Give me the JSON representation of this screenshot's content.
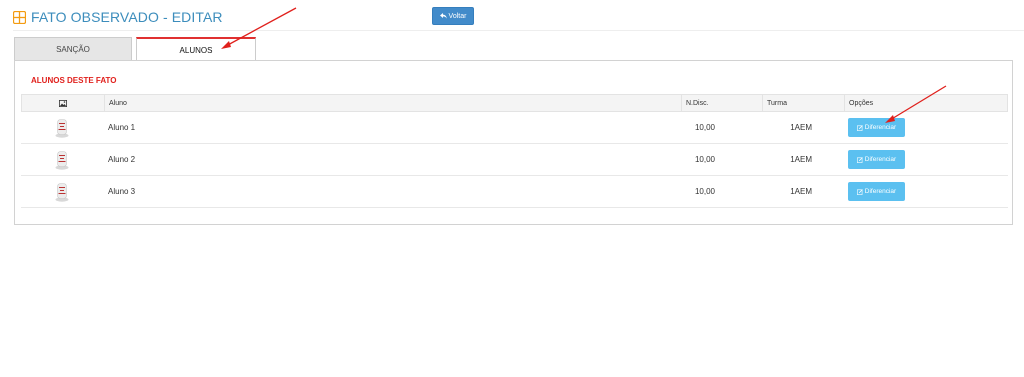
{
  "header": {
    "title": "FATO OBSERVADO - EDITAR",
    "icon": "table-grid-icon"
  },
  "toolbar": {
    "back_label": "Voltar",
    "back_icon": "reply-arrow-icon"
  },
  "tabs": [
    {
      "label": "SANÇÃO",
      "active": false
    },
    {
      "label": "ALUNOS",
      "active": true
    }
  ],
  "panel": {
    "title": "ALUNOS DESTE FATO"
  },
  "table": {
    "headers": {
      "photo_icon": "image-icon",
      "aluno": "Aluno",
      "ndisc": "N.Disc.",
      "turma": "Turma",
      "opcoes": "Opções"
    },
    "rows": [
      {
        "aluno": "Aluno 1",
        "ndisc": "10,00",
        "turma": "1AEM",
        "action": "Diferenciar"
      },
      {
        "aluno": "Aluno 2",
        "ndisc": "10,00",
        "turma": "1AEM",
        "action": "Diferenciar"
      },
      {
        "aluno": "Aluno 3",
        "ndisc": "10,00",
        "turma": "1AEM",
        "action": "Diferenciar"
      }
    ]
  },
  "colors": {
    "title_blue": "#3c8dbc",
    "accent_red": "#e0201c",
    "button_blue": "#428bca",
    "action_blue": "#5bc0f0"
  }
}
